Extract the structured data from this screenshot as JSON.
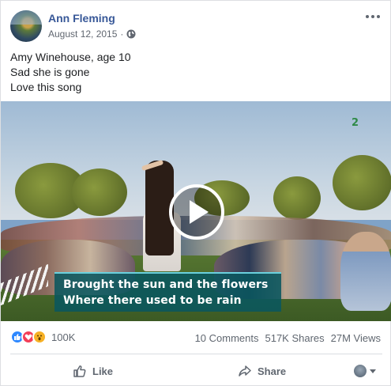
{
  "post": {
    "author": "Ann Fleming",
    "date": "August 12, 2015",
    "separator": "·",
    "privacy_icon": "globe-icon",
    "text_lines": [
      "Amy Winehouse, age 10",
      "Sad she is gone",
      "Love this song"
    ]
  },
  "video": {
    "channel_number": "2",
    "subtitle_lines": [
      "Brought the sun and the flowers",
      "Where there used to be rain"
    ],
    "play_icon": "play-icon"
  },
  "engagement": {
    "reaction_icons": [
      "like-icon",
      "love-icon",
      "wow-icon"
    ],
    "reaction_count": "100K",
    "comments": "10 Comments",
    "shares": "517K Shares",
    "views": "27M Views"
  },
  "actions": {
    "like_label": "Like",
    "share_label": "Share"
  },
  "colors": {
    "author_link": "#385898",
    "meta_text": "#616770",
    "like_blue": "#2d88ff",
    "love_red": "#f33e58",
    "wow_yellow": "#f7b125",
    "subtitle_bg": "#09565e"
  }
}
